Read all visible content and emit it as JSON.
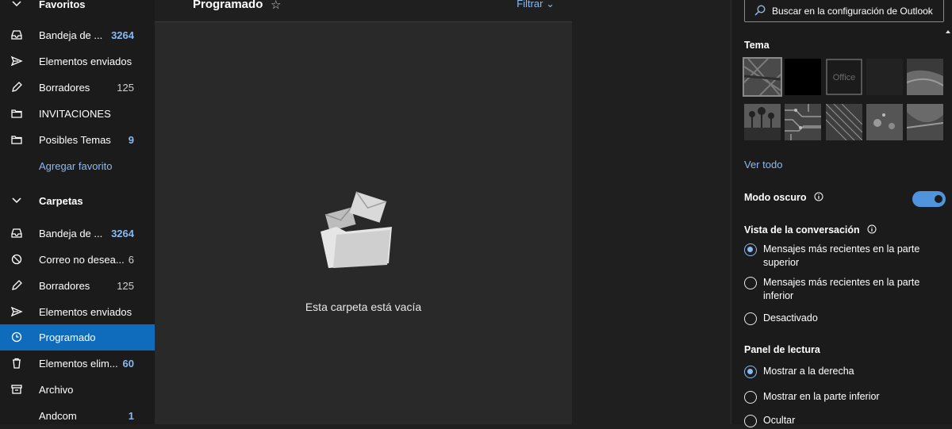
{
  "nav": {
    "favorites_header": "Favoritos",
    "favorites": [
      {
        "label": "Bandeja de ...",
        "count": "3264",
        "icon": "inbox-icon"
      },
      {
        "label": "Elementos enviados",
        "count": "",
        "icon": "send-icon"
      },
      {
        "label": "Borradores",
        "count": "125",
        "icon": "pencil-icon"
      },
      {
        "label": "INVITACIONES",
        "count": "",
        "icon": "folder-icon"
      },
      {
        "label": "Posibles Temas",
        "count": "9",
        "icon": "folder-icon"
      }
    ],
    "add_favorite": "Agregar favorito",
    "folders_header": "Carpetas",
    "folders": [
      {
        "label": "Bandeja de ...",
        "count": "3264",
        "icon": "inbox-icon"
      },
      {
        "label": "Correo no desea...",
        "count": "6",
        "icon": "blocked-icon"
      },
      {
        "label": "Borradores",
        "count": "125",
        "icon": "pencil-icon"
      },
      {
        "label": "Elementos enviados",
        "count": "",
        "icon": "send-icon"
      },
      {
        "label": "Programado",
        "count": "",
        "icon": "clock-icon"
      },
      {
        "label": "Elementos elim...",
        "count": "60",
        "icon": "trash-icon"
      },
      {
        "label": "Archivo",
        "count": "",
        "icon": "archive-icon"
      },
      {
        "label": "Andcom",
        "count": "1",
        "icon": "folder-icon"
      }
    ]
  },
  "list": {
    "title": "Programado",
    "star": "☆",
    "filter": "Filtrar",
    "empty_message": "Esta carpeta está vacía"
  },
  "settings": {
    "search_placeholder": "Buscar en la configuración de Outlook",
    "theme_title": "Tema",
    "theme_office_label": "Office",
    "see_all": "Ver todo",
    "dark_mode": "Modo oscuro",
    "dark_mode_on": true,
    "conversation_title": "Vista de la conversación",
    "conversation_options": [
      "Mensajes más recientes en la parte superior",
      "Mensajes más recientes en la parte inferior",
      "Desactivado"
    ],
    "conversation_selected": 0,
    "reading_title": "Panel de lectura",
    "reading_options": [
      "Mostrar a la derecha",
      "Mostrar en la parte inferior",
      "Ocultar"
    ],
    "reading_selected": 0
  },
  "colors": {
    "accent": "#0f6cbd",
    "link": "#8ab9f1",
    "toggle": "#4f94dc"
  }
}
